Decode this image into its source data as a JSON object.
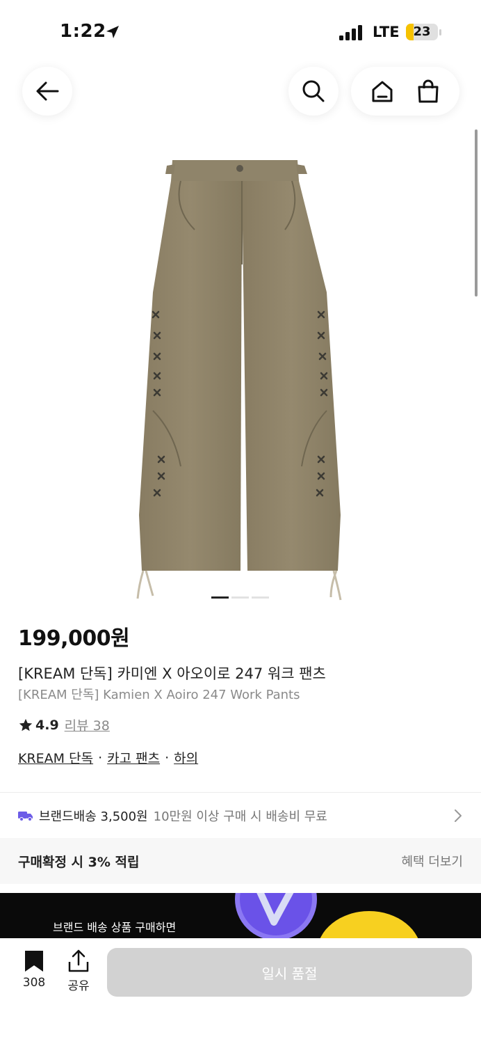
{
  "status_bar": {
    "time": "1:22",
    "network": "LTE",
    "battery_level": "23",
    "battery_fraction": 0.23,
    "battery_color": "#f6c200"
  },
  "nav": {
    "back_icon": "arrow-left-icon",
    "search_icon": "search-icon",
    "home_icon": "home-icon",
    "cart_icon": "shopping-bag-icon"
  },
  "image_carousel": {
    "total": 3,
    "active_index": 0
  },
  "product": {
    "price": "199,000원",
    "title_ko": "[KREAM 단독] 카미엔 X 아오이로 247 워크 팬츠",
    "title_en": "[KREAM 단독] Kamien X Aoiro 247 Work Pants",
    "rating": "4.9",
    "review_label": "리뷰 38",
    "tags": [
      "KREAM 단독",
      "카고 팬츠",
      "하의"
    ]
  },
  "shipping": {
    "label": "브랜드배송 3,500원",
    "note": "10만원 이상 구매 시 배송비 무료",
    "icon_color": "#6c5ce7"
  },
  "benefit": {
    "text": "구매확정 시 3% 적립",
    "more": "혜택 더보기"
  },
  "banner": {
    "text": "브랜드 배송 상품 구매하면"
  },
  "bottom_bar": {
    "bookmark_count": "308",
    "share_label": "공유",
    "action_label": "일시 품절"
  }
}
